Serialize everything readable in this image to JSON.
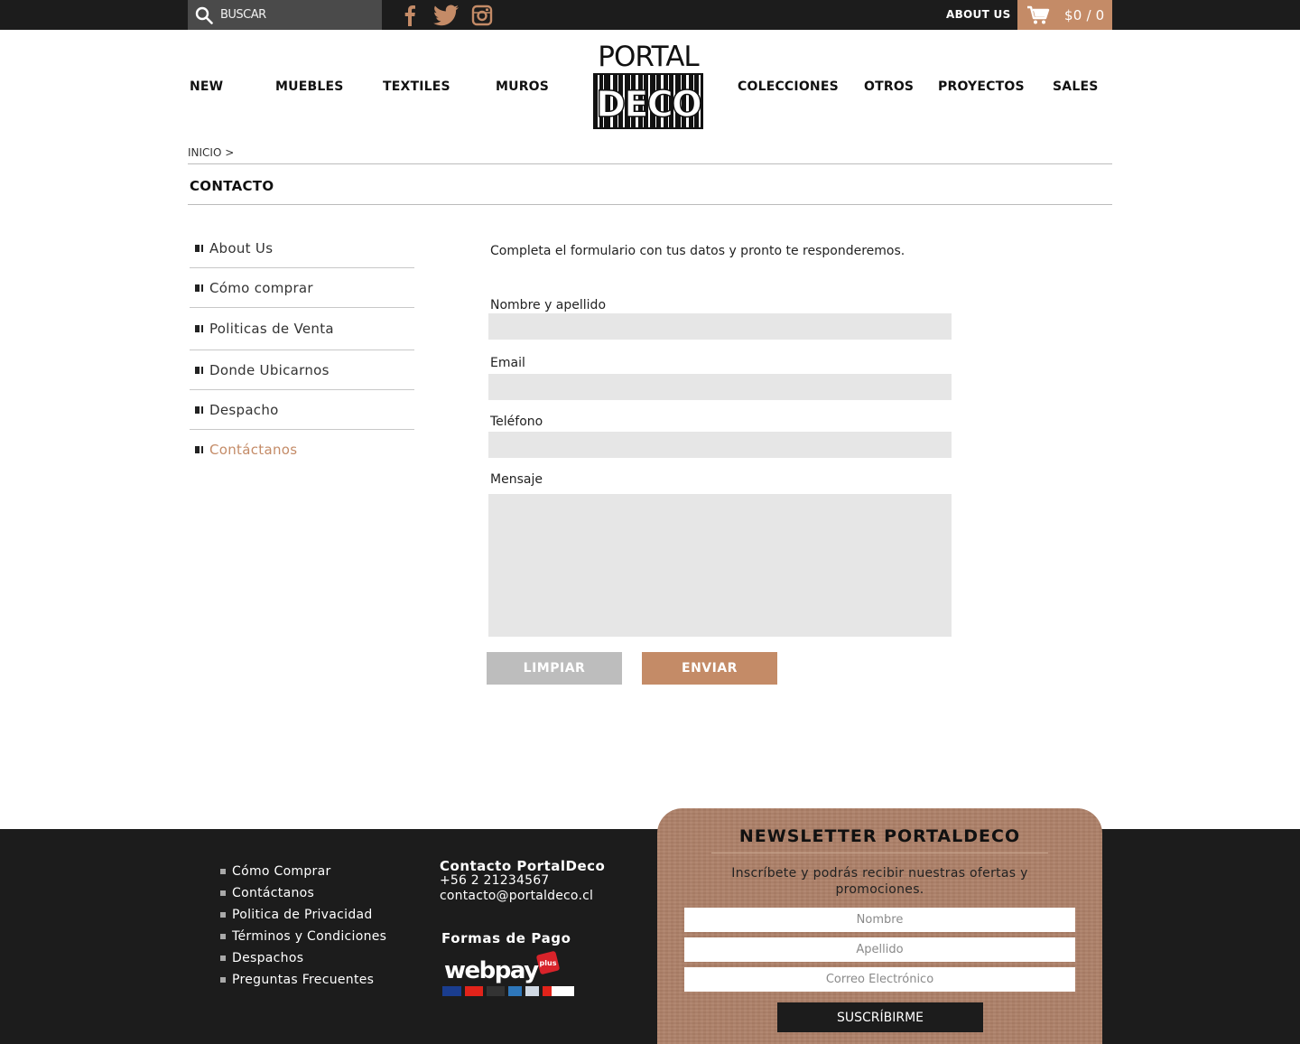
{
  "topbar": {
    "search_placeholder": "BUSCAR",
    "about_label": "ABOUT US",
    "cart_value": "$0 / 0"
  },
  "nav": {
    "left": [
      "NEW",
      "MUEBLES",
      "TEXTILES",
      "MUROS"
    ],
    "right": [
      "COLECCIONES",
      "OTROS",
      "PROYECTOS",
      "SALES"
    ]
  },
  "logo": {
    "line1": "PORTAL",
    "line2": "DECO"
  },
  "breadcrumb": "INICIO >",
  "page_title": "CONTACTO",
  "side_menu": {
    "items": [
      "About Us",
      "Cómo comprar",
      "Politicas de Venta",
      "Donde Ubicarnos",
      "Despacho",
      "Contáctanos"
    ]
  },
  "form": {
    "intro": "Completa el formulario con tus datos y pronto te responderemos.",
    "labels": {
      "name": "Nombre y apellido",
      "email": "Email",
      "phone": "Teléfono",
      "message": "Mensaje"
    },
    "clear_label": "LIMPIAR",
    "send_label": "ENVIAR"
  },
  "footer": {
    "links": [
      "Cómo Comprar",
      "Contáctanos",
      "Politica de Privacidad",
      "Términos y Condiciones",
      "Despachos",
      "Preguntas Frecuentes"
    ],
    "contact_title": "Contacto PortalDeco",
    "phone": "+56 2 21234567",
    "email": "contacto@portaldeco.cl",
    "payment_title": "Formas de Pago",
    "webpay_word": "webpay",
    "webpay_badge": "plus"
  },
  "newsletter": {
    "title": "NEWSLETTER PORTALDECO",
    "text": "Inscríbete y podrás recibir nuestras ofertas y promociones.",
    "name_placeholder": "Nombre",
    "lastname_placeholder": "Apellido",
    "email_placeholder": "Correo Electrónico",
    "subscribe_label": "SUSCRÍBIRME"
  },
  "colors": {
    "accent": "#c48b67",
    "dark": "#1c1c1c",
    "field": "#e6e6e6",
    "newsletter_bg": "#ad8068"
  }
}
